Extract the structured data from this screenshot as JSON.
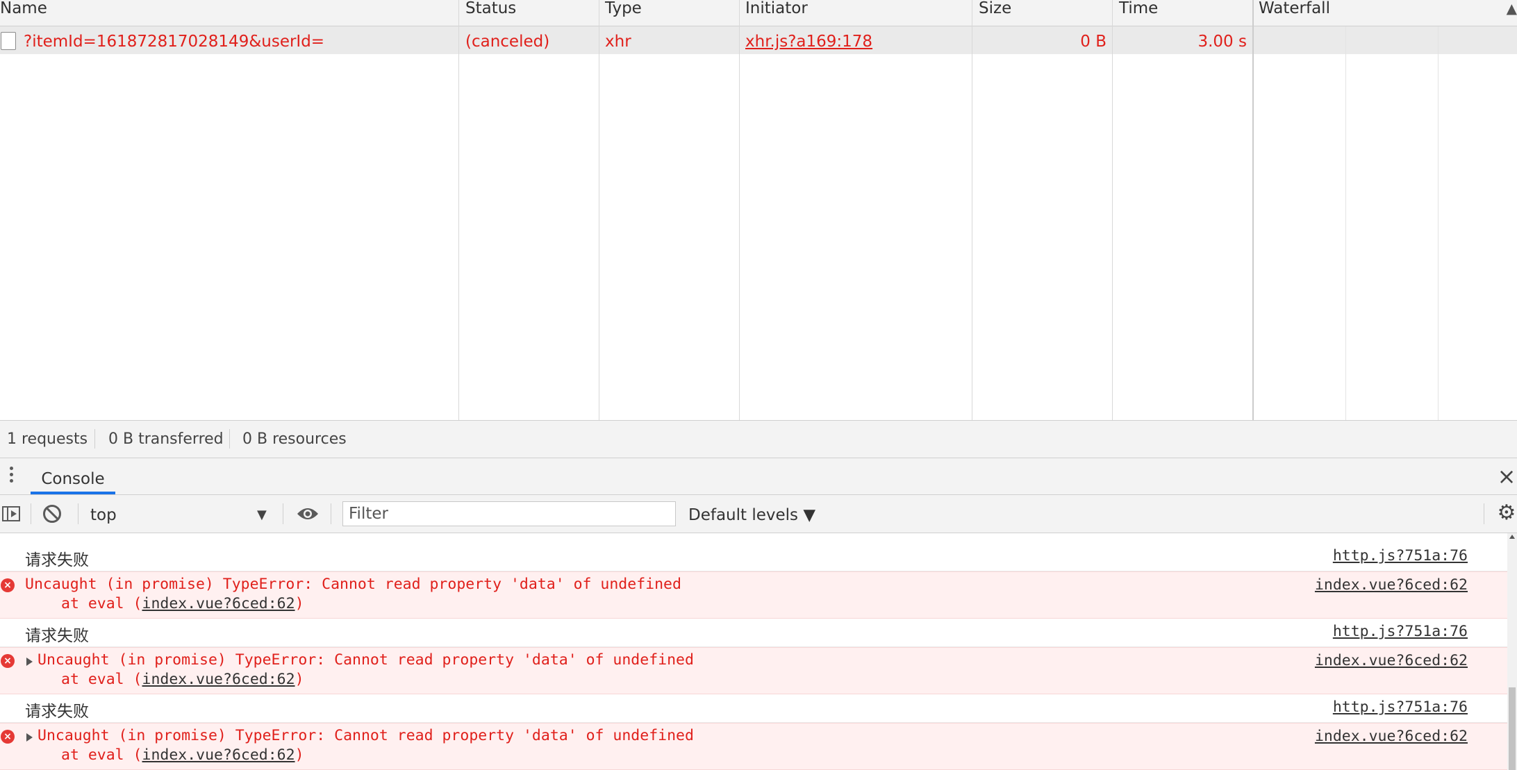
{
  "network": {
    "columns": [
      "Name",
      "Status",
      "Type",
      "Initiator",
      "Size",
      "Time",
      "Waterfall"
    ],
    "requests": [
      {
        "name": "?itemId=161872817028149&userId=",
        "status": "(canceled)",
        "type": "xhr",
        "initiator": "xhr.js?a169:178",
        "size": "0 B",
        "time": "3.00 s"
      }
    ],
    "summary": {
      "requests": "1 requests",
      "transferred": "0 B transferred",
      "resources": "0 B resources"
    }
  },
  "drawer": {
    "tab_label": "Console",
    "close_icon": "×"
  },
  "console_toolbar": {
    "context": "top",
    "context_arrow": "▼",
    "filter_placeholder": "Filter",
    "levels_label": "Default levels ▼",
    "gear_icon": "⚙"
  },
  "console": {
    "messages": [
      {
        "kind": "log",
        "text": "请求失败",
        "source": "http.js?751a:76"
      },
      {
        "kind": "error",
        "expandable": false,
        "text": "Uncaught (in promise) TypeError: Cannot read property 'data' of undefined",
        "at_prefix": "at eval (",
        "at_link": "index.vue?6ced:62",
        "at_suffix": ")",
        "source": "index.vue?6ced:62"
      },
      {
        "kind": "log",
        "text": "请求失败",
        "source": "http.js?751a:76"
      },
      {
        "kind": "error",
        "expandable": true,
        "text": "Uncaught (in promise) TypeError: Cannot read property 'data' of undefined",
        "at_prefix": "at eval (",
        "at_link": "index.vue?6ced:62",
        "at_suffix": ")",
        "source": "index.vue?6ced:62"
      },
      {
        "kind": "log",
        "text": "请求失败",
        "source": "http.js?751a:76"
      },
      {
        "kind": "error",
        "expandable": true,
        "text": "Uncaught (in promise) TypeError: Cannot read property 'data' of undefined",
        "at_prefix": "at eval (",
        "at_link": "index.vue?6ced:62",
        "at_suffix": ")",
        "source": "index.vue?6ced:62"
      }
    ]
  },
  "colors": {
    "error_text": "#e0201b",
    "error_bg": "#fff0f0",
    "accent": "#1a73e8",
    "panel_bg": "#f3f3f3"
  }
}
